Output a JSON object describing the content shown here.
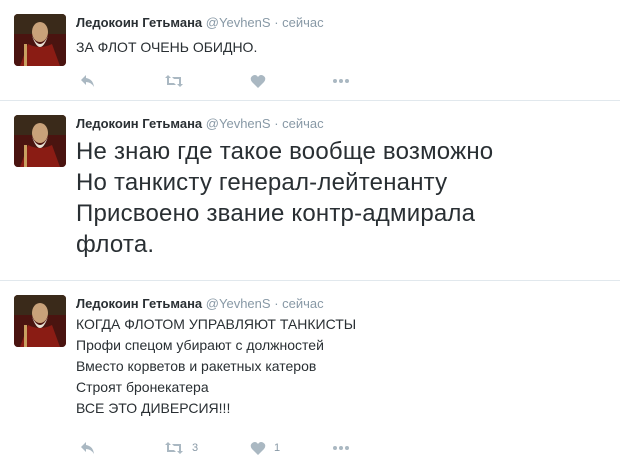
{
  "tweets": [
    {
      "author": "Ледокоин Гетьмана",
      "handle": "@YevhenS",
      "separator": "·",
      "time": "сейчас",
      "lines": [
        "ЗА ФЛОТ ОЧЕНЬ ОБИДНО."
      ],
      "retweets": "",
      "likes": ""
    },
    {
      "author": "Ледокоин Гетьмана",
      "handle": "@YevhenS",
      "separator": "·",
      "time": "сейчас",
      "lines": [
        "Не знаю где такое вообще возможно",
        "Но танкисту генерал-лейтенанту",
        "Присвоено звание контр-адмирала",
        "флота."
      ],
      "retweets": "",
      "likes": ""
    },
    {
      "author": "Ледокоин Гетьмана",
      "handle": "@YevhenS",
      "separator": "·",
      "time": "сейчас",
      "lines": [
        "КОГДА ФЛОТОМ УПРАВЛЯЮТ ТАНКИСТЫ",
        "Профи спецом убирают с должностей",
        "Вместо корветов и ракетных катеров",
        "Строят бронекатера",
        "ВСЕ ЭТО ДИВЕРСИЯ!!!"
      ],
      "retweets": "3",
      "likes": "1"
    }
  ],
  "icons": {
    "reply": "reply-icon",
    "retweet": "retweet-icon",
    "like": "heart-icon",
    "more": "more-icon"
  },
  "colors": {
    "icon_gray": "#aab8c2",
    "text_gray": "#8899a6",
    "divider": "#e1e8ed"
  }
}
